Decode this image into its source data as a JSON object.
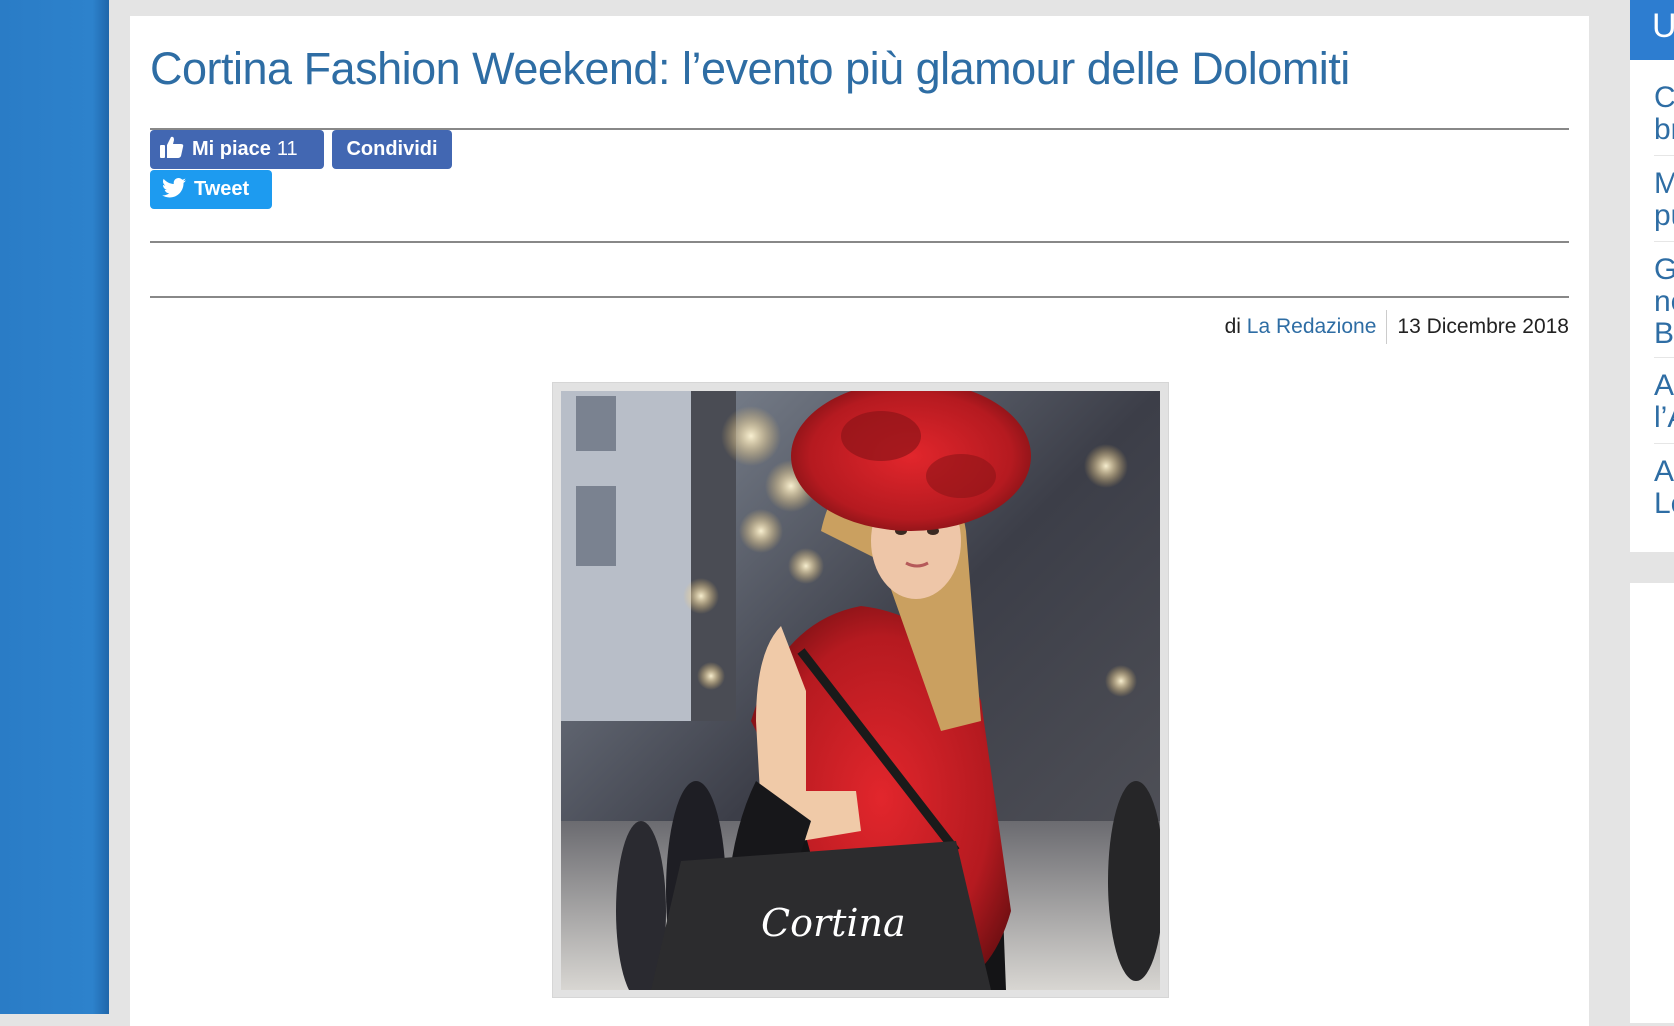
{
  "article": {
    "title": "Cortina Fashion Weekend: l’evento più glamour delle Dolomiti",
    "social": {
      "like_label": "Mi piace",
      "like_count": "11",
      "share_label": "Condividi",
      "tweet_label": "Tweet"
    },
    "byline": {
      "prefix": "di",
      "author": "La Redazione",
      "date": "13 Dicembre 2018"
    },
    "image": {
      "bag_text": "Cortina"
    }
  },
  "sidebar": {
    "header": "U",
    "items": [
      "C\nbr",
      "M\npu",
      "G\nne\nB",
      "A\nl’A",
      "A\nLe"
    ]
  },
  "colors": {
    "link_blue": "#2e6da4",
    "facebook_blue": "#4267b2",
    "twitter_blue": "#1d9bf0",
    "page_strip_blue": "#2d82cc"
  }
}
